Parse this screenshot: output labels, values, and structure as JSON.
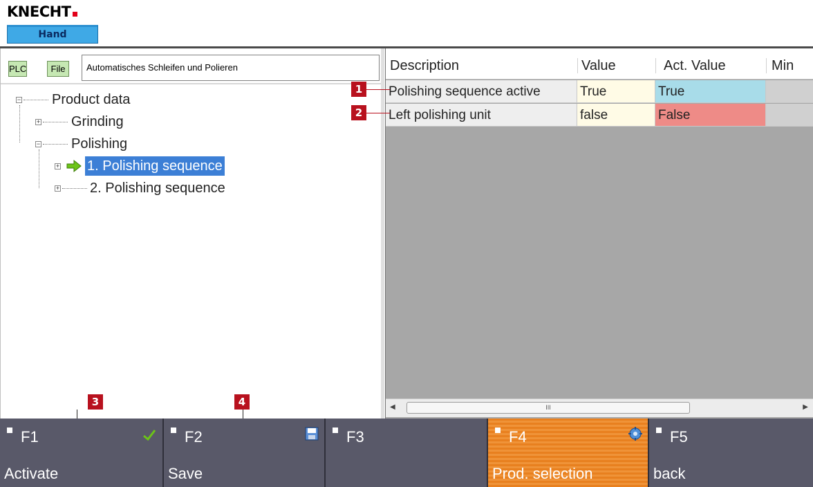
{
  "header": {
    "logo_text": "KNECHT",
    "mode_badge": "Hand"
  },
  "path_bar": {
    "plc_label": "PLC",
    "file_label": "File",
    "path_value": "Automatisches Schleifen und Polieren"
  },
  "tree": {
    "root": "Product data",
    "items": [
      {
        "label": "Grinding"
      },
      {
        "label": "Polishing"
      },
      {
        "label": "1. Polishing sequence",
        "selected": true
      },
      {
        "label": "2. Polishing sequence"
      }
    ]
  },
  "grid": {
    "columns": [
      "Description",
      "Value",
      "Act. Value",
      "Min"
    ],
    "rows": [
      {
        "description": "Polishing sequence active",
        "value": "True",
        "act_value": "True",
        "act_color": "#a8dce9"
      },
      {
        "description": "Left polishing unit",
        "value": "false",
        "act_value": "False",
        "act_color": "#ee8b87"
      }
    ],
    "scroll_thumb_glyph": "III"
  },
  "markers": [
    "1",
    "2",
    "3",
    "4"
  ],
  "fkeys": [
    {
      "code": "F1",
      "label": "Activate",
      "icon": "check-icon"
    },
    {
      "code": "F2",
      "label": "Save",
      "icon": "save-icon"
    },
    {
      "code": "F3",
      "label": ""
    },
    {
      "code": "F4",
      "label": "Prod. selection",
      "icon": "gear-icon",
      "active": true
    },
    {
      "code": "F5",
      "label": "back"
    }
  ],
  "colors": {
    "accent_active_key": "#e8801f",
    "marker_red": "#b8111e",
    "selection_blue": "#3c7fd6",
    "mode_badge_blue": "#3fa9e6"
  }
}
